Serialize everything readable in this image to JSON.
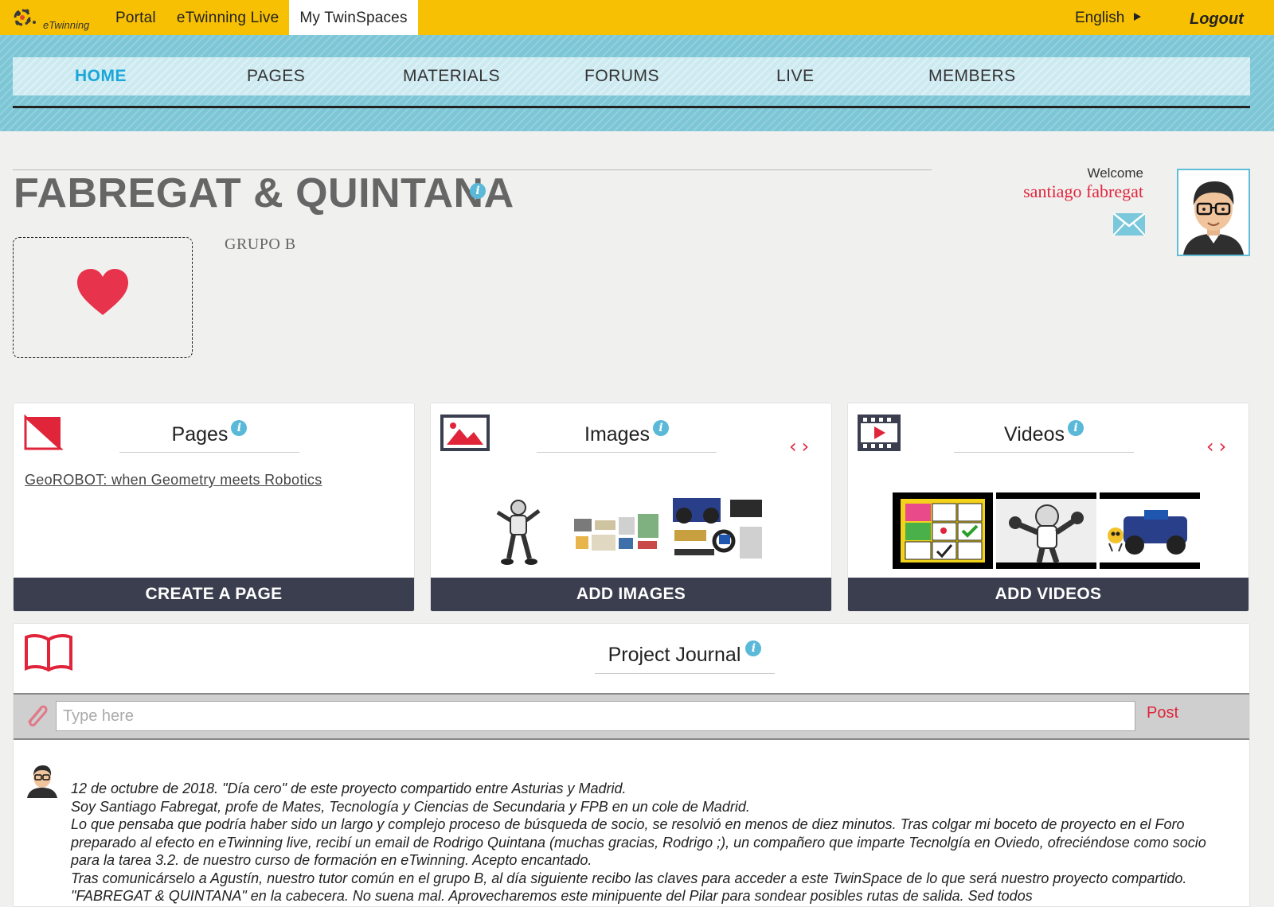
{
  "topbar": {
    "logo_text": "eTwinning",
    "nav": [
      "Portal",
      "eTwinning Live",
      "My TwinSpaces"
    ],
    "language": "English",
    "logout": "Logout"
  },
  "sections": [
    "HOME",
    "PAGES",
    "MATERIALS",
    "FORUMS",
    "LIVE",
    "MEMBERS"
  ],
  "project": {
    "title": "FABREGAT & QUINTANA",
    "subtitle": "GRUPO B"
  },
  "user": {
    "welcome": "Welcome",
    "name": "santiago fabregat"
  },
  "cards": {
    "pages": {
      "title": "Pages",
      "link": "GeoROBOT: when Geometry meets Robotics",
      "button": "CREATE A PAGE"
    },
    "images": {
      "title": "Images",
      "button": "ADD IMAGES"
    },
    "videos": {
      "title": "Videos",
      "button": "ADD VIDEOS"
    }
  },
  "journal": {
    "title": "Project Journal",
    "input_placeholder": "Type here",
    "post_label": "Post",
    "entry_lines": [
      "12 de octubre de 2018. \"Día cero\" de este proyecto compartido entre Asturias y Madrid.",
      "Soy Santiago Fabregat, profe de Mates, Tecnología y Ciencias de Secundaria y FPB en un cole de Madrid.",
      "Lo que pensaba que podría haber sido un largo y complejo proceso de búsqueda de socio, se resolvió en menos de diez minutos. Tras colgar mi boceto de proyecto en el Foro preparado al efecto en eTwinning live, recibí un email de Rodrigo Quintana (muchas gracias, Rodrigo ;), un compañero que imparte Tecnolgía en Oviedo, ofreciéndose como socio para la tarea 3.2. de nuestro curso de formación en eTwinning. Acepto encantado.",
      "Tras comunicárselo a Agustín, nuestro tutor común en el grupo B, al día siguiente recibo las claves para acceder a este TwinSpace de lo que será nuestro proyecto compartido. \"FABREGAT & QUINTANA\" en la cabecera. No suena mal. Aprovecharemos este minipuente del Pilar para sondear posibles rutas de salida. Sed todos"
    ]
  },
  "colors": {
    "accent_yellow": "#f7c002",
    "nav_blue": "#7cc6d6",
    "active_blue": "#1aa7d9",
    "brand_red": "#e0253b",
    "button_dark": "#3a3e4f"
  }
}
